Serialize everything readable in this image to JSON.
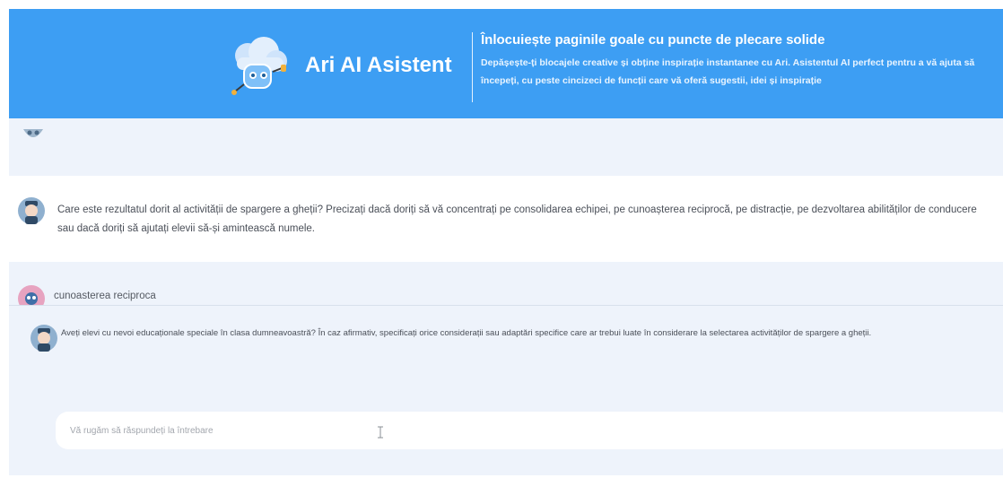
{
  "header": {
    "brand_name": "Ari AI Asistent",
    "tagline": "Înlocuiește paginile goale cu puncte de plecare solide",
    "subtitle": "Depășește-ți blocajele creative și obține inspirație instantanee cu Ari. Asistentul AI perfect pentru a vă ajuta să începeți, cu peste cincizeci de funcții care vă oferă sugestii, idei și inspirație",
    "bg_color": "#3d9ef3",
    "logo_icon": "robot-cloud-icon"
  },
  "chat": {
    "messages": [
      {
        "role": "assistant",
        "avatar_icon": "assistant-avatar-icon",
        "text": "Care este rezultatul dorit al activității de spargere a gheții? Precizați dacă doriți să vă concentrați pe consolidarea echipei, pe cunoașterea reciprocă, pe distracție, pe dezvoltarea abilităților de conducere sau dacă doriți să ajutați elevii să-și amintească numele."
      },
      {
        "role": "user",
        "avatar_icon": "user-avatar-icon",
        "text": "cunoasterea reciproca"
      }
    ]
  },
  "question_panel": {
    "avatar_icon": "assistant-avatar-icon",
    "question": "Aveți elevi cu nevoi educaționale speciale în clasa dumneavoastră? În caz afirmativ, specificați orice considerații sau adaptări specifice care ar trebui luate în considerare la selectarea activităților de spargere a gheții.",
    "input_placeholder": "Vă rugăm să răspundeți la întrebare",
    "cursor_icon": "text-cursor-icon"
  }
}
